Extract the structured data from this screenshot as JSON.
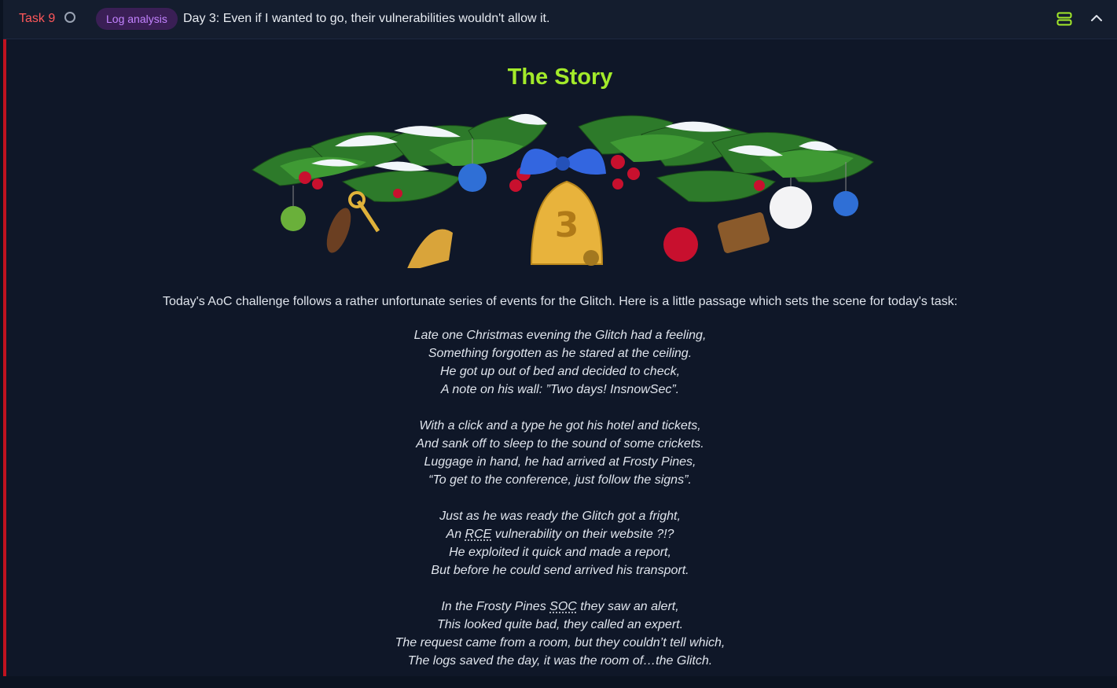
{
  "header": {
    "task_label": "Task 9",
    "tag": "Log analysis",
    "title": "Day 3: Even if I wanted to go, their vulnerabilities wouldn't allow it.",
    "icons": [
      "status-circle-icon",
      "layout-icon",
      "chevron-up-icon"
    ],
    "colors": {
      "task_label": "#ff575a",
      "tag_bg": "#3a1f55",
      "tag_text": "#c383ff",
      "layout_icon": "#a3ea2a",
      "accent_bar": "#c1121f"
    }
  },
  "content": {
    "heading": "The Story",
    "heading_color": "#a3ea2a",
    "banner_image": "christmas-garland-with-bell-number-3",
    "intro": "Today's AoC challenge follows a rather unfortunate series of events for the Glitch. Here is a little passage which sets the scene for today's task:",
    "poem": {
      "stanza1": {
        "line1": "Late one Christmas evening the Glitch had a feeling,",
        "line2": "Something forgotten as he stared at the ceiling.",
        "line3": "He got up out of bed and decided to check,",
        "line4": "A note on his wall: ”Two days! InsnowSec”."
      },
      "stanza2": {
        "line1": "With a click and a type he got his hotel and tickets,",
        "line2": "And sank off to sleep to the sound of some crickets.",
        "line3": "Luggage in hand, he had arrived at Frosty Pines,",
        "line4": "“To get to the conference, just follow the signs”."
      },
      "stanza3": {
        "line1": "Just as he was ready the Glitch got a fright,",
        "line2_pre": "An ",
        "line2_abbr": "RCE",
        "line2_post": " vulnerability on their website ?!?",
        "line3": "He exploited it quick and made a report,",
        "line4": "But before he could send arrived his transport."
      },
      "stanza4": {
        "line1_pre": "In the Frosty Pines ",
        "line1_abbr": "SOC",
        "line1_post": " they saw an alert,",
        "line2": "This looked quite bad, they called an expert.",
        "line3": "The request came from a room, but they couldn’t tell which,",
        "line4": "The logs saved the day, it was the room of…the Glitch."
      }
    }
  }
}
